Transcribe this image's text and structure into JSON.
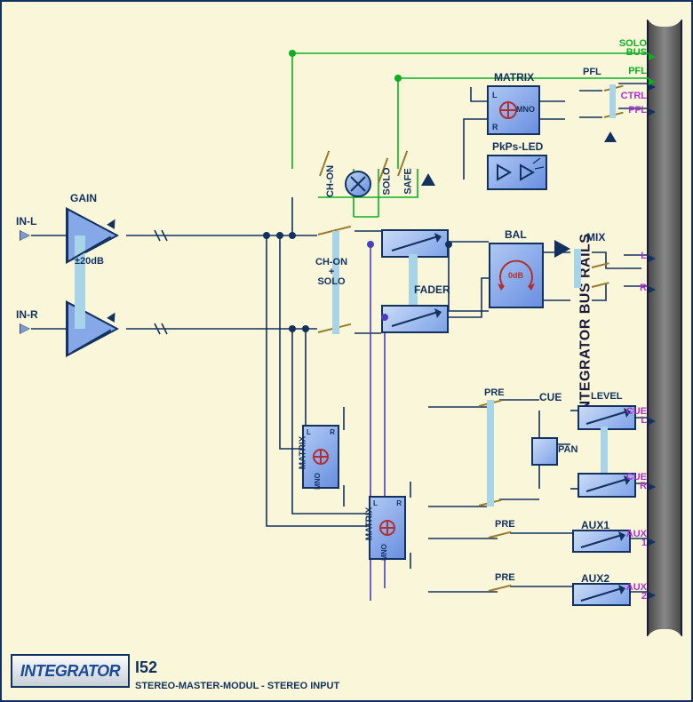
{
  "module_code": "I52",
  "module_name": "STEREO-MASTER-MODUL - STEREO INPUT",
  "brand": "INTEGRATOR",
  "bus_label": "INTEGRATOR BUS RAILS",
  "inputs": {
    "left": "IN-L",
    "right": "IN-R"
  },
  "gain": {
    "label": "GAIN",
    "range": "±20dB"
  },
  "switches": {
    "ch_on": "CH-ON",
    "solo": "SOLO",
    "safe": "SAFE",
    "ch_on_solo": "CH-ON\n+\nSOLO",
    "pre1": "PRE",
    "pre2": "PRE",
    "pre3": "PRE",
    "pfl": "PFL"
  },
  "blocks": {
    "matrix": "MATRIX",
    "pkps": "PkPs-LED",
    "fader": "FADER",
    "bal": "BAL",
    "bal_center": "0dB",
    "cue": "CUE",
    "pan": "PAN",
    "level": "LEVEL",
    "aux1": "AUX1",
    "aux2": "AUX2",
    "mix": "MIX",
    "mno": "MNO",
    "lr_l": "L",
    "lr_r": "R"
  },
  "outs": {
    "solo_bus": "SOLO\nBUS",
    "pfl1": "PFL",
    "ctrl": "CTRL",
    "pfl2": "PFL",
    "mix_l": "L",
    "mix_r": "R",
    "cue_l": "CUE\nL",
    "cue_r": "CUE\nR",
    "aux1": "AUX\n1",
    "aux2": "AUX\n2"
  }
}
